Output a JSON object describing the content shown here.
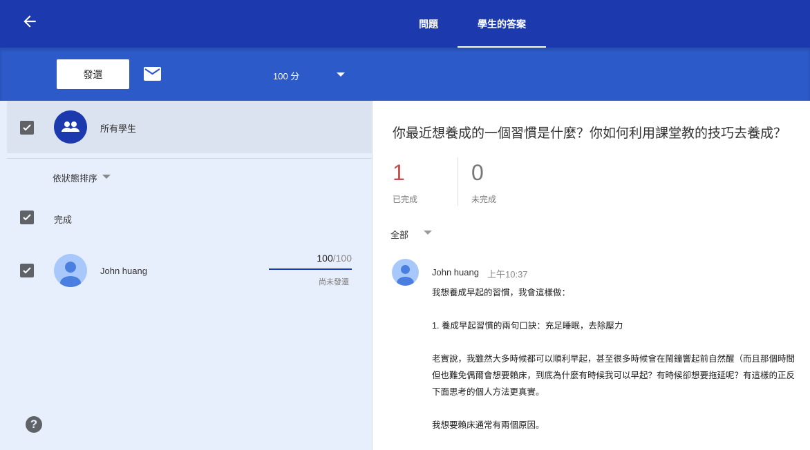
{
  "header": {
    "tabs": [
      {
        "label": "問題",
        "active": false
      },
      {
        "label": "學生的答案",
        "active": true
      }
    ]
  },
  "toolbar": {
    "return_label": "發還",
    "points_label": "100 分"
  },
  "left": {
    "all_students": "所有學生",
    "sort_label": "依狀態排序",
    "group_label": "完成",
    "student": {
      "name": "John huang",
      "grade": "100",
      "max": "/100",
      "status": "尚未發還"
    },
    "help": "?"
  },
  "right": {
    "question": "你最近想養成的一個習慣是什麼？你如何利用課堂教的技巧去養成？",
    "done_count": "1",
    "done_label": "已完成",
    "not_done_count": "0",
    "not_done_label": "未完成",
    "filter_label": "全部",
    "answer": {
      "name": "John huang",
      "time": "上午10:37",
      "lines": [
        "我想養成早起的習慣，我會這樣做：",
        "",
        "1. 養成早起習慣的兩句口訣：充足睡眠，去除壓力",
        "",
        "老實說，我雖然大多時候都可以順利早起，甚至很多時候會在鬧鐘響起前自然醒（而且那個時間",
        "但也難免偶爾會想要賴床，到底為什麼有時候我可以早起？有時候卻想要拖延呢？有這樣的正反",
        "下面思考的個人方法更真實。",
        "",
        "我想要賴床通常有兩個原因。"
      ]
    }
  },
  "colors": {
    "header": "#1c3aae",
    "toolbar": "#2c5ac8",
    "accent": "#1c3aae"
  }
}
